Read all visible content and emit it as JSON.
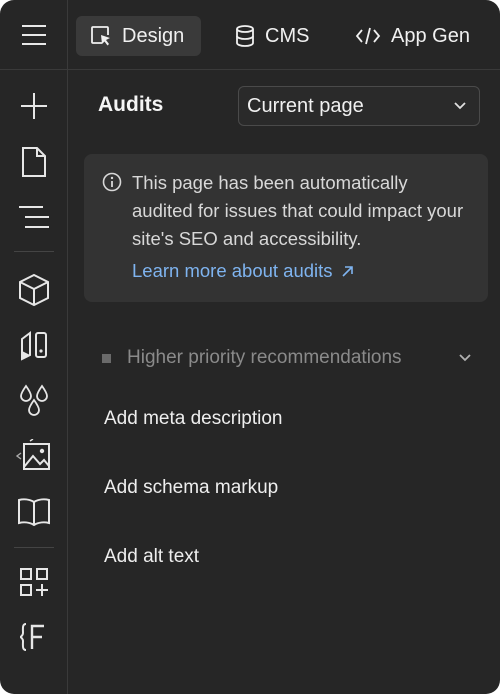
{
  "tabs": [
    {
      "label": "Design",
      "icon": "cursor-box-icon",
      "active": true
    },
    {
      "label": "CMS",
      "icon": "database-icon",
      "active": false
    },
    {
      "label": "App Gen",
      "icon": "code-icon",
      "active": false
    }
  ],
  "rail": {
    "items": [
      {
        "name": "add",
        "icon": "plus-icon"
      },
      {
        "name": "pages",
        "icon": "page-icon"
      },
      {
        "name": "navigator",
        "icon": "navigator-icon"
      },
      {
        "name": "components",
        "icon": "cube-icon"
      },
      {
        "name": "styles",
        "icon": "style-selector-icon"
      },
      {
        "name": "variables",
        "icon": "drops-icon"
      },
      {
        "name": "assets",
        "icon": "image-icon"
      },
      {
        "name": "docs",
        "icon": "book-icon"
      },
      {
        "name": "apps",
        "icon": "apps-grid-icon"
      },
      {
        "name": "code",
        "icon": "code-brackets-f-icon"
      }
    ]
  },
  "panel": {
    "title": "Audits",
    "scope_select": {
      "value": "Current page"
    },
    "info": {
      "text": "This page has been automatically audited for issues that could impact your site's SEO and accessibility.",
      "link": "Learn more about audits"
    },
    "section": {
      "label": "Higher priority recommendations",
      "items": [
        "Add meta description",
        "Add schema markup",
        "Add alt text"
      ]
    }
  },
  "colors": {
    "background": "#262626",
    "card": "#333333",
    "link": "#7fb4f0",
    "border": "#3a3a3a"
  }
}
